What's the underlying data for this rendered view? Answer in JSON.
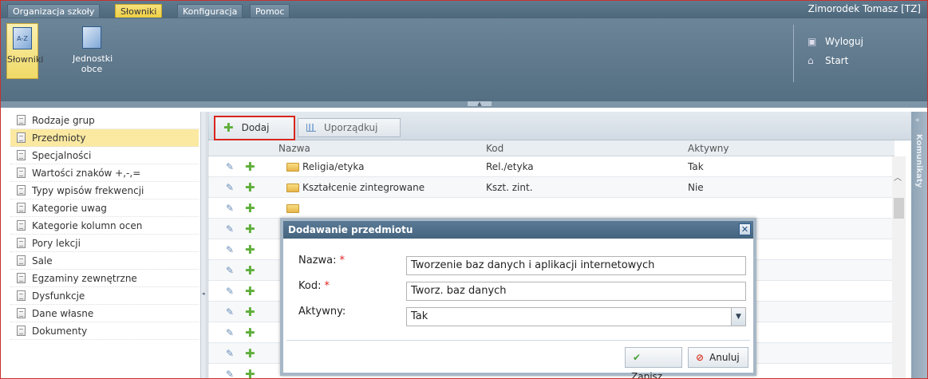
{
  "topbar": {
    "tabs": [
      "Organizacja szkoły",
      "Słowniki",
      "Konfiguracja",
      "Pomoc"
    ],
    "user": "Zimorodek Tomasz [TZ]"
  },
  "ribbon": {
    "buttons": [
      "Słowniki",
      "Jednostki obce"
    ],
    "links": [
      "Wyloguj",
      "Start"
    ]
  },
  "sidebar": {
    "items": [
      "Rodzaje grup",
      "Przedmioty",
      "Specjalności",
      "Wartości znaków +,-,=",
      "Typy wpisów frekwencji",
      "Kategorie uwag",
      "Kategorie kolumn ocen",
      "Pory lekcji",
      "Sale",
      "Egzaminy zewnętrzne",
      "Dysfunkcje",
      "Dane własne",
      "Dokumenty"
    ],
    "selected": "Przedmioty"
  },
  "toolbar": {
    "add_label": "Dodaj",
    "sort_label": "Uporządkuj"
  },
  "table": {
    "headers": [
      "Nazwa",
      "Kod",
      "Aktywny"
    ],
    "rows": [
      {
        "name": "Religia/etyka",
        "code": "Rel./etyka",
        "active": "Tak"
      },
      {
        "name": "Kształcenie zintegrowane",
        "code": "Kszt. zint.",
        "active": "Nie"
      }
    ]
  },
  "side_panel": {
    "title": "Komunikaty"
  },
  "dialog": {
    "title": "Dodawanie przedmiotu",
    "close": "✕",
    "fields": {
      "name_label": "Nazwa:",
      "name_value": "Tworzenie baz danych i aplikacji internetowych",
      "code_label": "Kod:",
      "code_value": "Tworz. baz danych",
      "active_label": "Aktywny:",
      "active_value": "Tak",
      "required_mark": "*"
    },
    "save_label": "Zapisz",
    "cancel_label": "Anuluj"
  },
  "colors": {
    "accent": "#eecf43",
    "header": "#546e82",
    "required": "#e02020"
  }
}
